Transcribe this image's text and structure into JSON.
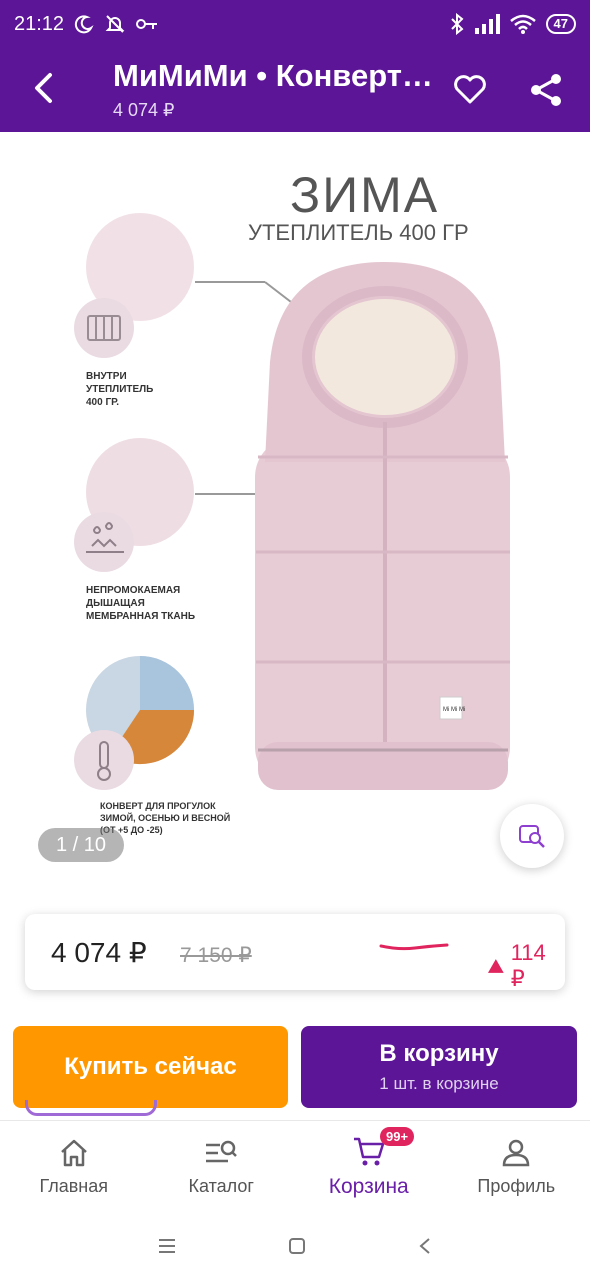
{
  "status_bar": {
    "time": "21:12",
    "battery": "47"
  },
  "header": {
    "title": "МиМиМи • Конверт…",
    "price": "4 074 ₽"
  },
  "product_image": {
    "title": "ЗИМА",
    "subtitle": "УТЕПЛИТЕЛЬ 400 ГР",
    "features": [
      {
        "text": "ВНУТРИ\nУТЕПЛИТЕЛЬ\n400 ГР."
      },
      {
        "text": "НЕПРОМОКАЕМАЯ\nДЫШАЩАЯ\nМЕМБРАННАЯ ТКАНЬ"
      },
      {
        "text": "КОНВЕРТ ДЛЯ ПРОГУЛОК\nЗИМОЙ, ОСЕНЬЮ И ВЕСНОЙ\n(ОТ +5 ДО -25)"
      }
    ],
    "tag_text": "Mi Mi Mi",
    "counter": "1 / 10"
  },
  "price_card": {
    "current_price": "4 074 ₽",
    "old_price": "7 150 ₽",
    "change": "114 ₽"
  },
  "actions": {
    "buy_now": "Купить сейчас",
    "add_to_cart": "В корзину",
    "cart_count": "1 шт. в корзине"
  },
  "bottom_nav": {
    "items": [
      {
        "label": "Главная",
        "icon": "home-icon"
      },
      {
        "label": "Каталог",
        "icon": "catalog-search-icon"
      },
      {
        "label": "Корзина",
        "icon": "cart-icon",
        "badge": "99+"
      },
      {
        "label": "Профиль",
        "icon": "profile-icon"
      }
    ]
  },
  "colors": {
    "brand": "#5b1596",
    "accent": "#ff9800",
    "price_up": "#e0245e"
  }
}
